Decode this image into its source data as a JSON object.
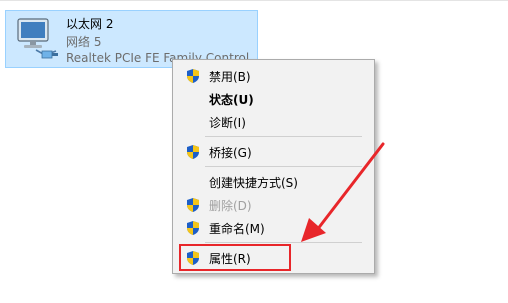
{
  "adapter": {
    "name": "以太网 2",
    "status": "网络  5",
    "device": "Realtek PCIe FE Family Control"
  },
  "menu": {
    "items": [
      {
        "label": "禁用(B)",
        "shield": true,
        "bold": false,
        "disabled": false
      },
      {
        "label": "状态(U)",
        "shield": false,
        "bold": true,
        "disabled": false
      },
      {
        "label": "诊断(I)",
        "shield": false,
        "bold": false,
        "disabled": false
      },
      {
        "label": "桥接(G)",
        "shield": true,
        "bold": false,
        "disabled": false
      },
      {
        "label": "创建快捷方式(S)",
        "shield": false,
        "bold": false,
        "disabled": false
      },
      {
        "label": "删除(D)",
        "shield": true,
        "bold": false,
        "disabled": true
      },
      {
        "label": "重命名(M)",
        "shield": true,
        "bold": false,
        "disabled": false
      },
      {
        "label": "属性(R)",
        "shield": true,
        "bold": false,
        "disabled": false
      }
    ]
  },
  "colors": {
    "selection": "#cce8ff",
    "highlight": "#e8262a",
    "shield_blue": "#1d5fc7",
    "shield_yellow": "#f5c518"
  },
  "icons": {
    "adapter": "network-adapter-icon",
    "shield": "uac-shield-icon",
    "annotation": "red-arrow-icon"
  }
}
